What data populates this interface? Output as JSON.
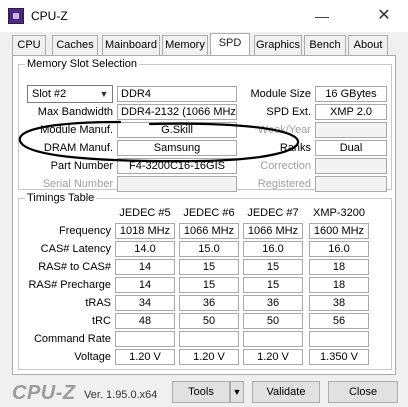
{
  "window": {
    "title": "CPU-Z"
  },
  "tabs": [
    "CPU",
    "Caches",
    "Mainboard",
    "Memory",
    "SPD",
    "Graphics",
    "Bench",
    "About"
  ],
  "active_tab": "SPD",
  "slot_section": {
    "title": "Memory Slot Selection",
    "slot_value": "Slot #2",
    "memory_type": "DDR4",
    "module_size_label": "Module Size",
    "module_size": "16 GBytes",
    "max_bandwidth_label": "Max Bandwidth",
    "max_bandwidth": "DDR4-2132 (1066 MHz)",
    "spd_ext_label": "SPD Ext.",
    "spd_ext": "XMP 2.0",
    "module_manuf_label": "Module Manuf.",
    "module_manuf": "G.Skill",
    "week_year_label": "Week/Year",
    "week_year": "",
    "dram_manuf_label": "DRAM Manuf.",
    "dram_manuf": "Samsung",
    "ranks_label": "Ranks",
    "ranks": "Dual",
    "part_number_label": "Part Number",
    "part_number": "F4-3200C16-16GIS",
    "correction_label": "Correction",
    "correction": "",
    "serial_number_label": "Serial Number",
    "serial_number": "",
    "registered_label": "Registered",
    "registered": ""
  },
  "timings": {
    "title": "Timings Table",
    "columns": [
      "JEDEC #5",
      "JEDEC #6",
      "JEDEC #7",
      "XMP-3200"
    ],
    "rows": [
      {
        "label": "Frequency",
        "values": [
          "1018 MHz",
          "1066 MHz",
          "1066 MHz",
          "1600 MHz"
        ]
      },
      {
        "label": "CAS# Latency",
        "values": [
          "14.0",
          "15.0",
          "16.0",
          "16.0"
        ]
      },
      {
        "label": "RAS# to CAS#",
        "values": [
          "14",
          "15",
          "15",
          "18"
        ]
      },
      {
        "label": "RAS# Precharge",
        "values": [
          "14",
          "15",
          "15",
          "18"
        ]
      },
      {
        "label": "tRAS",
        "values": [
          "34",
          "36",
          "36",
          "38"
        ]
      },
      {
        "label": "tRC",
        "values": [
          "48",
          "50",
          "50",
          "56"
        ]
      },
      {
        "label": "Command Rate",
        "values": [
          "",
          "",
          "",
          ""
        ]
      },
      {
        "label": "Voltage",
        "values": [
          "1.20 V",
          "1.20 V",
          "1.20 V",
          "1.350 V"
        ]
      }
    ]
  },
  "footer": {
    "logo": "CPU-Z",
    "version": "Ver. 1.95.0.x64",
    "tools_label": "Tools",
    "validate_label": "Validate",
    "close_label": "Close"
  },
  "icons": {
    "app": "cpu-z-app-icon",
    "minimize": "minimize-icon",
    "close": "close-icon",
    "dropdown": "chevron-down-icon"
  },
  "colors": {
    "annotation": "#000000",
    "active_tab_bg": "#ffffff",
    "panel_bg": "#ffffff"
  }
}
